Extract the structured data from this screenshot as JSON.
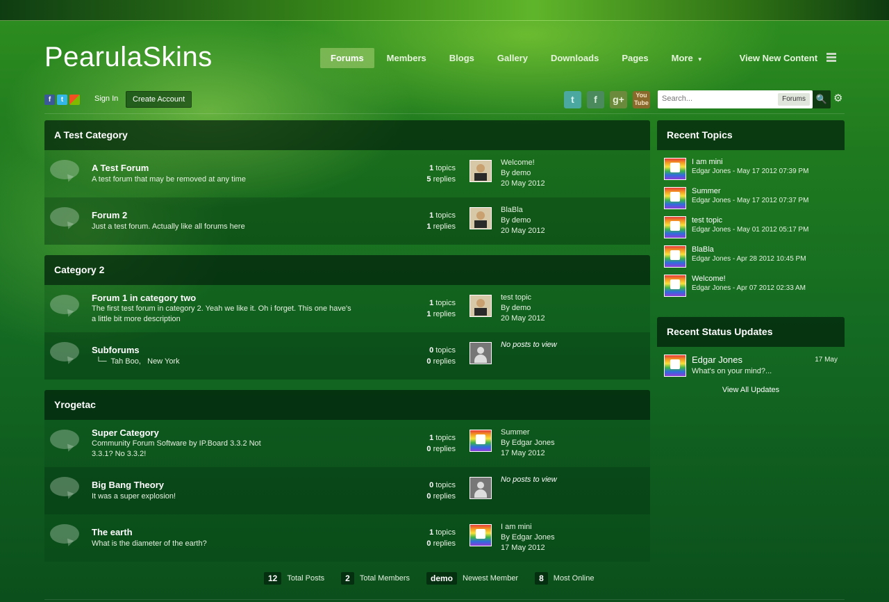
{
  "brand": {
    "logo_bold": "Pearula",
    "logo_thin": "Skins"
  },
  "nav": {
    "items": [
      {
        "label": "Forums",
        "active": true
      },
      {
        "label": "Members"
      },
      {
        "label": "Blogs"
      },
      {
        "label": "Gallery"
      },
      {
        "label": "Downloads"
      },
      {
        "label": "Pages"
      }
    ],
    "more_label": "More",
    "view_new_content": "View New Content"
  },
  "user_bar": {
    "sign_in": "Sign In",
    "create_account": "Create Account"
  },
  "share_icons": [
    "facebook-icon",
    "twitter-icon",
    "windows-live-icon"
  ],
  "social_icons": [
    "twitter-icon",
    "facebook-icon",
    "google-plus-icon",
    "youtube-icon"
  ],
  "search": {
    "placeholder": "Search...",
    "scope": "Forums"
  },
  "categories": [
    {
      "name": "A Test Category",
      "forums": [
        {
          "title": "A Test Forum",
          "desc": "A test forum that may be removed at any time",
          "topics": "1",
          "replies": "5",
          "last_title": "Welcome!",
          "last_by": "By demo",
          "last_date": "20 May 2012",
          "avatar": "face"
        },
        {
          "title": "Forum 2",
          "desc": "Just a test forum. Actually like all forums here",
          "topics": "1",
          "replies": "1",
          "last_title": "BlaBla",
          "last_by": "By demo",
          "last_date": "20 May 2012",
          "avatar": "face"
        }
      ]
    },
    {
      "name": "Category 2",
      "forums": [
        {
          "title": "Forum 1 in category two",
          "desc": "The first test forum in category 2. Yeah we like it. Oh i forget. This one have's a little bit more description",
          "topics": "1",
          "replies": "1",
          "last_title": "test topic",
          "last_by": "By demo",
          "last_date": "20 May 2012",
          "avatar": "face"
        },
        {
          "title": "Subforums",
          "subforums": [
            "Tah Boo",
            "New York"
          ],
          "topics": "0",
          "replies": "0",
          "no_posts": "No posts to view",
          "avatar": "gray"
        }
      ]
    },
    {
      "name": "Yrogetac",
      "forums": [
        {
          "title": "Super Category",
          "desc": "Community Forum Software by IP.Board 3.3.2 Not 3.3.1? No 3.3.2!",
          "topics": "1",
          "replies": "0",
          "last_title": "Summer",
          "last_by": "By Edgar Jones",
          "last_date": "17 May 2012",
          "avatar": "rainbow"
        },
        {
          "title": "Big Bang Theory",
          "desc": "It was a super explosion!",
          "topics": "0",
          "replies": "0",
          "no_posts": "No posts to view",
          "avatar": "gray"
        },
        {
          "title": "The earth",
          "desc": "What is the diameter of the earth?",
          "topics": "1",
          "replies": "0",
          "last_title": "I am mini",
          "last_by": "By Edgar Jones",
          "last_date": "17 May 2012",
          "avatar": "rainbow"
        }
      ]
    }
  ],
  "labels": {
    "topics": "topics",
    "replies": "replies"
  },
  "recent_topics": {
    "title": "Recent Topics",
    "items": [
      {
        "title": "I am mini",
        "meta": "Edgar Jones - May 17 2012 07:39 PM"
      },
      {
        "title": "Summer",
        "meta": "Edgar Jones - May 17 2012 07:37 PM"
      },
      {
        "title": "test topic",
        "meta": "Edgar Jones - May 01 2012 05:17 PM"
      },
      {
        "title": "BlaBla",
        "meta": "Edgar Jones - Apr 28 2012 10:45 PM"
      },
      {
        "title": "Welcome!",
        "meta": "Edgar Jones - Apr 07 2012 02:33 AM"
      }
    ]
  },
  "status_updates": {
    "title": "Recent Status Updates",
    "name": "Edgar Jones",
    "date": "17 May",
    "message": "What's on your mind?...",
    "view_all": "View All Updates"
  },
  "board_stats": [
    {
      "value": "12",
      "label": "Total Posts"
    },
    {
      "value": "2",
      "label": "Total Members"
    },
    {
      "value": "demo",
      "label": "Newest Member"
    },
    {
      "value": "8",
      "label": "Most Online"
    }
  ],
  "colors": {
    "accent": "#a6cf7a",
    "header_dark": "#06210c"
  }
}
